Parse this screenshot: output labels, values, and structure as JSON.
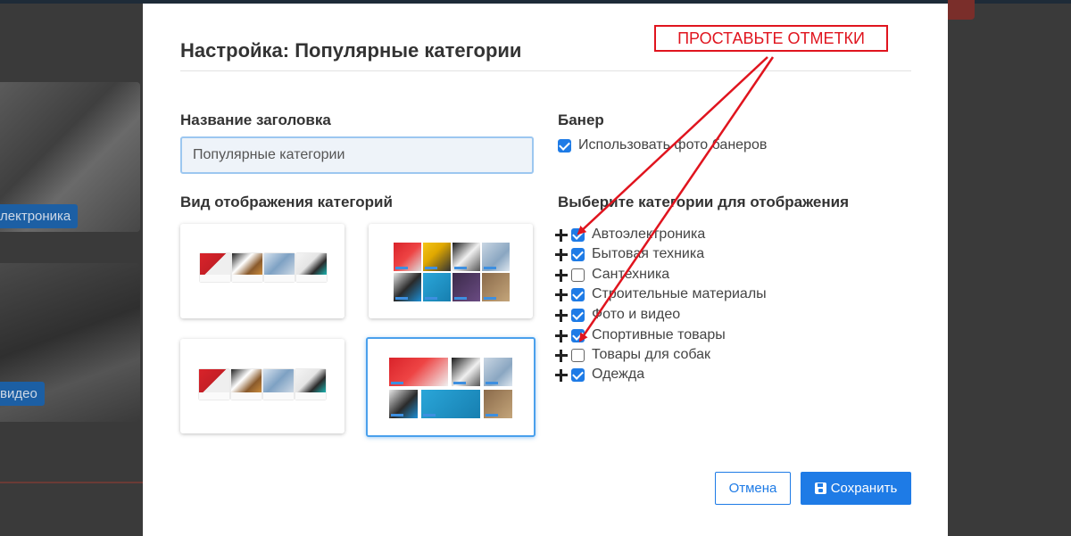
{
  "background": {
    "tile_badges": [
      "лектроника",
      "видео"
    ]
  },
  "modal": {
    "title": "Настройка: Популярные категории",
    "heading_field": {
      "label": "Название заголовка",
      "value": "Популярные категории"
    },
    "display_mode": {
      "label": "Вид отображения категорий",
      "options": [
        {
          "name": "row-small",
          "selected": false
        },
        {
          "name": "grid-2x3",
          "selected": false
        },
        {
          "name": "row-medium",
          "selected": false
        },
        {
          "name": "grid-mixed",
          "selected": true
        }
      ]
    },
    "banner": {
      "label": "Банер",
      "use_photo_label": "Использовать фото банеров",
      "use_photo_checked": true
    },
    "categories": {
      "label": "Выберите категории для отображения",
      "items": [
        {
          "label": "Автоэлектроника",
          "checked": true
        },
        {
          "label": "Бытовая техника",
          "checked": true
        },
        {
          "label": "Сантехника",
          "checked": false
        },
        {
          "label": "Строительные материалы",
          "checked": true
        },
        {
          "label": "Фото и видео",
          "checked": true
        },
        {
          "label": "Спортивные товары",
          "checked": true
        },
        {
          "label": "Товары для собак",
          "checked": false
        },
        {
          "label": "Одежда",
          "checked": true
        }
      ]
    },
    "buttons": {
      "cancel_label": "Отмена",
      "save_label": "Сохранить",
      "save_icon": "floppy-disk-icon"
    }
  },
  "annotation": {
    "text": "ПРОСТАВЬТЕ ОТМЕТКИ",
    "color": "#e0141e"
  },
  "colors": {
    "accent": "#1e7be6",
    "selected_card_border": "#4aa0ec"
  }
}
